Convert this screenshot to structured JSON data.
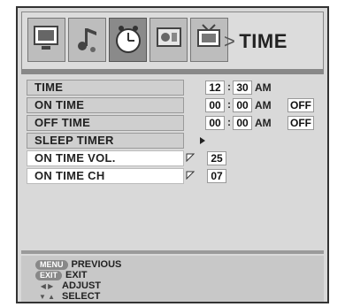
{
  "breadcrumb": {
    "arrow": ">",
    "title": "TIME"
  },
  "tabs": [
    {
      "name": "tv-picture-tab"
    },
    {
      "name": "audio-tab"
    },
    {
      "name": "time-tab"
    },
    {
      "name": "setup-tab"
    },
    {
      "name": "channel-tab"
    }
  ],
  "rows": [
    {
      "label": "TIME",
      "hour": "12",
      "minute": "30",
      "ampm": "AM"
    },
    {
      "label": "ON TIME",
      "hour": "00",
      "minute": "00",
      "ampm": "AM",
      "status": "OFF"
    },
    {
      "label": "OFF TIME",
      "hour": "00",
      "minute": "00",
      "ampm": "AM",
      "status": "OFF"
    },
    {
      "label": "SLEEP TIMER"
    },
    {
      "label": "ON TIME VOL.",
      "value": "25"
    },
    {
      "label": "ON TIME CH",
      "value": "07"
    }
  ],
  "footer": {
    "menu_pill": "MENU",
    "menu_text": "PREVIOUS",
    "exit_pill": "EXIT",
    "exit_text": "EXIT",
    "adjust_text": "ADJUST",
    "select_text": "SELECT"
  }
}
